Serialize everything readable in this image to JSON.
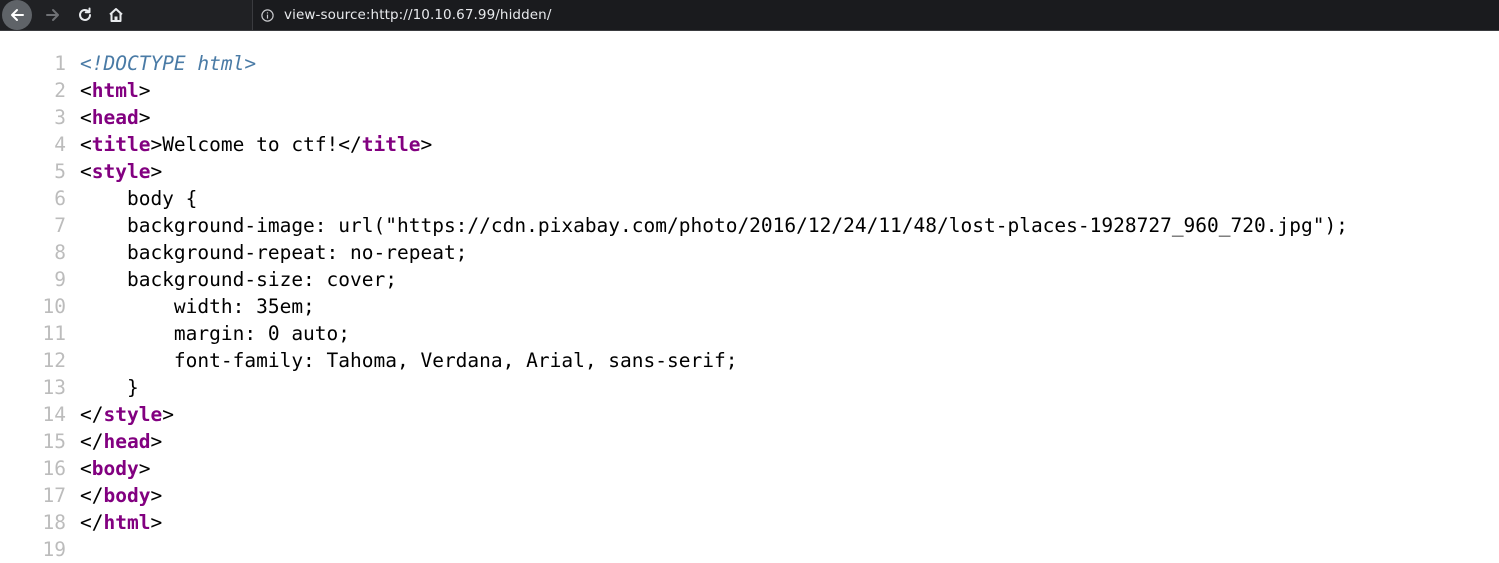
{
  "browser": {
    "url": "view-source:http://10.10.67.99/hidden/",
    "icons": {
      "back": "back-arrow-icon",
      "forward": "forward-arrow-icon",
      "reload": "reload-icon",
      "home": "home-icon",
      "info": "info-icon"
    }
  },
  "source": {
    "lines": [
      {
        "num": "1",
        "segments": [
          {
            "t": "<!DOCTYPE html>",
            "c": "doctype"
          }
        ]
      },
      {
        "num": "2",
        "segments": [
          {
            "t": "<",
            "c": "text"
          },
          {
            "t": "html",
            "c": "tag"
          },
          {
            "t": ">",
            "c": "text"
          }
        ]
      },
      {
        "num": "3",
        "segments": [
          {
            "t": "<",
            "c": "text"
          },
          {
            "t": "head",
            "c": "tag"
          },
          {
            "t": ">",
            "c": "text"
          }
        ]
      },
      {
        "num": "4",
        "segments": [
          {
            "t": "<",
            "c": "text"
          },
          {
            "t": "title",
            "c": "tag"
          },
          {
            "t": ">Welcome to ctf!</",
            "c": "text"
          },
          {
            "t": "title",
            "c": "tag"
          },
          {
            "t": ">",
            "c": "text"
          }
        ]
      },
      {
        "num": "5",
        "segments": [
          {
            "t": "<",
            "c": "text"
          },
          {
            "t": "style",
            "c": "tag"
          },
          {
            "t": ">",
            "c": "text"
          }
        ]
      },
      {
        "num": "6",
        "segments": [
          {
            "t": "    body {",
            "c": "text"
          }
        ]
      },
      {
        "num": "7",
        "segments": [
          {
            "t": "    background-image: url(\"https://cdn.pixabay.com/photo/2016/12/24/11/48/lost-places-1928727_960_720.jpg\");",
            "c": "text"
          }
        ]
      },
      {
        "num": "8",
        "segments": [
          {
            "t": "    background-repeat: no-repeat;",
            "c": "text"
          }
        ]
      },
      {
        "num": "9",
        "segments": [
          {
            "t": "    background-size: cover;",
            "c": "text"
          }
        ]
      },
      {
        "num": "10",
        "segments": [
          {
            "t": "        width: 35em;",
            "c": "text"
          }
        ]
      },
      {
        "num": "11",
        "segments": [
          {
            "t": "        margin: 0 auto;",
            "c": "text"
          }
        ]
      },
      {
        "num": "12",
        "segments": [
          {
            "t": "        font-family: Tahoma, Verdana, Arial, sans-serif;",
            "c": "text"
          }
        ]
      },
      {
        "num": "13",
        "segments": [
          {
            "t": "    }",
            "c": "text"
          }
        ]
      },
      {
        "num": "14",
        "segments": [
          {
            "t": "</",
            "c": "text"
          },
          {
            "t": "style",
            "c": "tag"
          },
          {
            "t": ">",
            "c": "text"
          }
        ]
      },
      {
        "num": "15",
        "segments": [
          {
            "t": "</",
            "c": "text"
          },
          {
            "t": "head",
            "c": "tag"
          },
          {
            "t": ">",
            "c": "text"
          }
        ]
      },
      {
        "num": "16",
        "segments": [
          {
            "t": "<",
            "c": "text"
          },
          {
            "t": "body",
            "c": "tag"
          },
          {
            "t": ">",
            "c": "text"
          }
        ]
      },
      {
        "num": "17",
        "segments": [
          {
            "t": "</",
            "c": "text"
          },
          {
            "t": "body",
            "c": "tag"
          },
          {
            "t": ">",
            "c": "text"
          }
        ]
      },
      {
        "num": "18",
        "segments": [
          {
            "t": "</",
            "c": "text"
          },
          {
            "t": "html",
            "c": "tag"
          },
          {
            "t": ">",
            "c": "text"
          }
        ]
      },
      {
        "num": "19",
        "segments": []
      }
    ]
  }
}
